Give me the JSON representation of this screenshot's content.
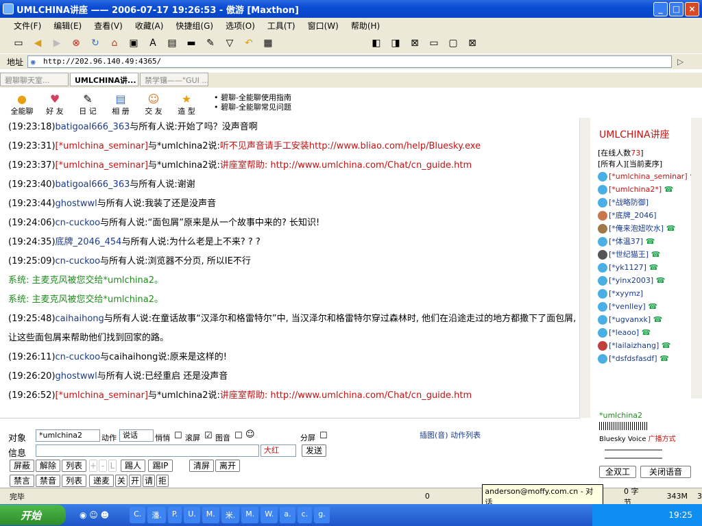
{
  "window": {
    "title": "UMLCHINA讲座 —— 2006-07-17 19:26:53 - 傲游 [Maxthon]"
  },
  "menu": [
    "文件(F)",
    "编辑(E)",
    "查看(V)",
    "收藏(A)",
    "快捷组(G)",
    "选项(O)",
    "工具(T)",
    "窗口(W)",
    "帮助(H)"
  ],
  "address": {
    "label": "地址",
    "url": "http://202.96.140.49:4365/"
  },
  "tabs": [
    "碧聊聊天室...",
    "UMLCHINA讲...",
    "禁学镶——\"GUI ..."
  ],
  "quickbar": {
    "items": [
      "全能聊",
      "好 友",
      "日 记",
      "相 册",
      "交 友",
      "造 型"
    ],
    "guides": [
      "• 碧聊-全能聊使用指南",
      "• 碧聊-全能聊常见问题"
    ]
  },
  "messages": [
    {
      "time": "(19:23:18)",
      "from": "batigoal666_363",
      "mid": "与所有人说:",
      "text": "开始了吗？没声音啊",
      "color": "normal"
    },
    {
      "time": "(19:23:31)",
      "from": "[*umlchina_seminar]",
      "mid": "与*umlchina2说:",
      "text": "听不见声音请手工安装http://www.bliao.com/help/Bluesky.exe",
      "color": "red"
    },
    {
      "time": "(19:23:37)",
      "from": "[*umlchina_seminar]",
      "mid": "与*umlchina2说:",
      "text": "讲座室帮助: http://www.umlchina.com/Chat/cn_guide.htm",
      "color": "red"
    },
    {
      "time": "(19:23:40)",
      "from": "batigoal666_363",
      "mid": "与所有人说:",
      "text": "谢谢",
      "color": "normal"
    },
    {
      "time": "(19:23:44)",
      "from": "ghostwwl",
      "mid": "与所有人说:",
      "text": "我装了还是没声音",
      "color": "normal"
    },
    {
      "time": "(19:24:06)",
      "from": "cn-cuckoo",
      "mid": "与所有人说:",
      "text": "“面包屑”原来是从一个故事中来的? 长知识!",
      "color": "normal"
    },
    {
      "time": "(19:24:35)",
      "from": "底牌_2046_454",
      "mid": "与所有人说:",
      "text": "为什么老是上不来? ? ?",
      "color": "normal"
    },
    {
      "time": "(19:25:09)",
      "from": "cn-cuckoo",
      "mid": "与所有人说:",
      "text": "浏览器不分页, 所以IE不行",
      "color": "normal"
    },
    {
      "time": "",
      "from": "系统:",
      "mid": "  主麦克风被您交给",
      "text": "*umlchina2。",
      "color": "system"
    },
    {
      "time": "",
      "from": "系统:",
      "mid": "  主麦克风被您交给",
      "text": "*umlchina2。",
      "color": "system"
    },
    {
      "time": "(19:25:48)",
      "from": "caihaihong",
      "mid": "与所有人说:",
      "text": "在童话故事“汉泽尔和格雷特尔”中, 当汉泽尔和格雷特尔穿过森林时, 他们在沿途走过的地方都撒下了面包屑, 让这些面包屑来帮助他们找到回家的路。",
      "color": "normal"
    },
    {
      "time": "(19:26:11)",
      "from": "cn-cuckoo",
      "mid": "与caihaihong说:",
      "text": "原来是这样的!",
      "color": "normal"
    },
    {
      "time": "(19:26:20)",
      "from": "ghostwwl",
      "mid": "与所有人说:",
      "text": "已经重启 还是没声音",
      "color": "normal"
    },
    {
      "time": "(19:26:52)",
      "from": "[*umlchina_seminar]",
      "mid": "与*umlchina2说:",
      "text": "讲座室帮助: http://www.umlchina.com/Chat/cn_guide.htm",
      "color": "red"
    }
  ],
  "sidebar": {
    "title": "UMLCHINA讲座",
    "online_label": "[在线人数",
    "online_count": "73",
    "online_close": "]",
    "links": "[所有人][当前麦序]",
    "users": [
      "[*umlchina_seminar]",
      "[*umlchina2*]",
      "[*战略防御]",
      "[*底牌_2046]",
      "[*俺来泡妞吹水]",
      "[*体温37]",
      "[*世纪猫王]",
      "[*yk1127]",
      "[*yinx2003]",
      "[*xyymz]",
      "[*venlley]",
      "[*ugvanxk]",
      "[*leaoo]",
      "[*lailaizhang]",
      "[*dsfdsfasdf]"
    ]
  },
  "voice": {
    "name": "*umlchina2",
    "brand": "Bluesky Voice",
    "mode": "广播方式",
    "btn1": "全双工",
    "btn2": "关闭语音"
  },
  "form": {
    "target_label": "对象",
    "target_value": "*umlchina2",
    "action_label": "动作",
    "action_value": "说话",
    "whisper": "悄悄",
    "scroll": "滚屏",
    "image": "图音",
    "split": "分屏",
    "insert": "插图(音) 动作列表",
    "info_label": "信息",
    "color_value": "大红",
    "send": "发送",
    "row1": [
      "屏蔽",
      "解除",
      "列表",
      "+",
      "-",
      "L",
      "踢人",
      "踢IP",
      "清屏",
      "离开"
    ],
    "row2": [
      "禁言",
      "禁音",
      "列表",
      "递麦",
      "关",
      "开",
      "请",
      "拒"
    ]
  },
  "status": {
    "text": "完毕",
    "count": "0",
    "popup": "anderson@moffy.com.cn - 对话",
    "bytes": "0 字节",
    "mem": "343M",
    "num": "3"
  },
  "taskbar": {
    "start": "开始",
    "tasks": [
      "C.",
      "潘.",
      "P.",
      "U.",
      "M.",
      "米.",
      "M.",
      "W.",
      "a.",
      "c.",
      "g."
    ],
    "clock": "19:25"
  }
}
